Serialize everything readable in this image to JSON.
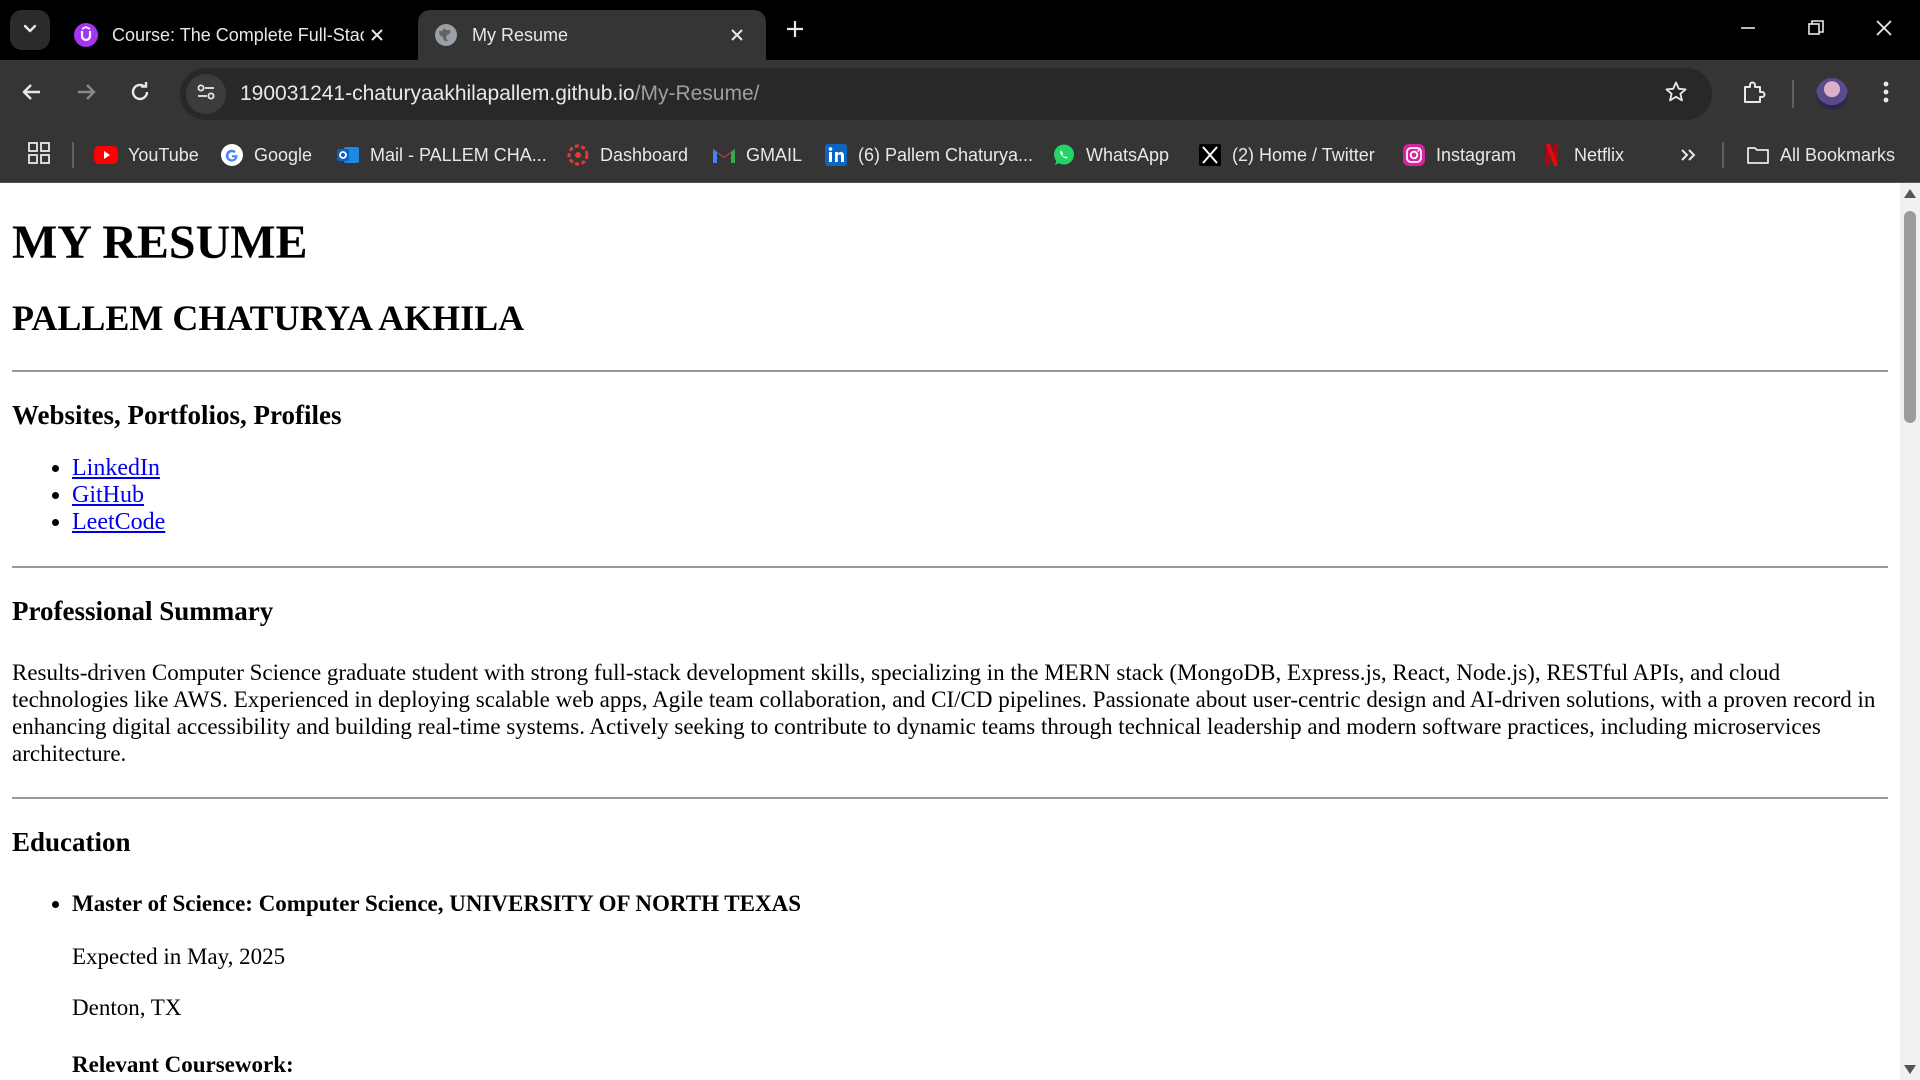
{
  "browser": {
    "tabs": [
      {
        "title": "Course: The Complete Full-Stack",
        "active": false,
        "favicon": "udemy-icon"
      },
      {
        "title": "My Resume",
        "active": true,
        "favicon": "globe-icon"
      }
    ],
    "url_host": "190031241-chaturyaakhilapallem.github.io",
    "url_path": "/My-Resume/",
    "bookmarks": [
      {
        "label": "YouTube",
        "icon": "youtube-icon"
      },
      {
        "label": "Google",
        "icon": "google-icon"
      },
      {
        "label": "Mail - PALLEM CHA...",
        "icon": "outlook-icon"
      },
      {
        "label": "Dashboard",
        "icon": "dashboard-icon"
      },
      {
        "label": "GMAIL",
        "icon": "gmail-icon"
      },
      {
        "label": "(6) Pallem Chaturya...",
        "icon": "linkedin-icon"
      },
      {
        "label": "WhatsApp",
        "icon": "whatsapp-icon"
      },
      {
        "label": "(2) Home / Twitter",
        "icon": "x-icon"
      },
      {
        "label": "Instagram",
        "icon": "instagram-icon"
      },
      {
        "label": "Netflix",
        "icon": "netflix-icon"
      }
    ],
    "all_bookmarks_label": "All Bookmarks"
  },
  "page": {
    "title": "MY RESUME",
    "name": "PALLEM CHATURYA AKHILA",
    "links_heading": "Websites, Portfolios, Profiles",
    "links": [
      "LinkedIn",
      "GitHub",
      "LeetCode"
    ],
    "summary_heading": "Professional Summary",
    "summary": "Results-driven Computer Science graduate student with strong full-stack development skills, specializing in the MERN stack (MongoDB, Express.js, React, Node.js), RESTful APIs, and cloud technologies like AWS. Experienced in deploying scalable web apps, Agile team collaboration, and CI/CD pipelines. Passionate about user-centric design and AI-driven solutions, with a proven record in enhancing digital accessibility and building real-time systems. Actively seeking to contribute to dynamic teams through technical leadership and modern software practices, including microservices architecture.",
    "education_heading": "Education",
    "education": [
      {
        "degree": "Master of Science: Computer Science, UNIVERSITY OF NORTH TEXAS",
        "expected": "Expected in May, 2025",
        "location": "Denton, TX",
        "coursework_label": "Relevant Coursework:"
      }
    ]
  },
  "colors": {
    "link": "#0000ee",
    "chrome_dark": "#000000",
    "toolbar": "#353535"
  }
}
